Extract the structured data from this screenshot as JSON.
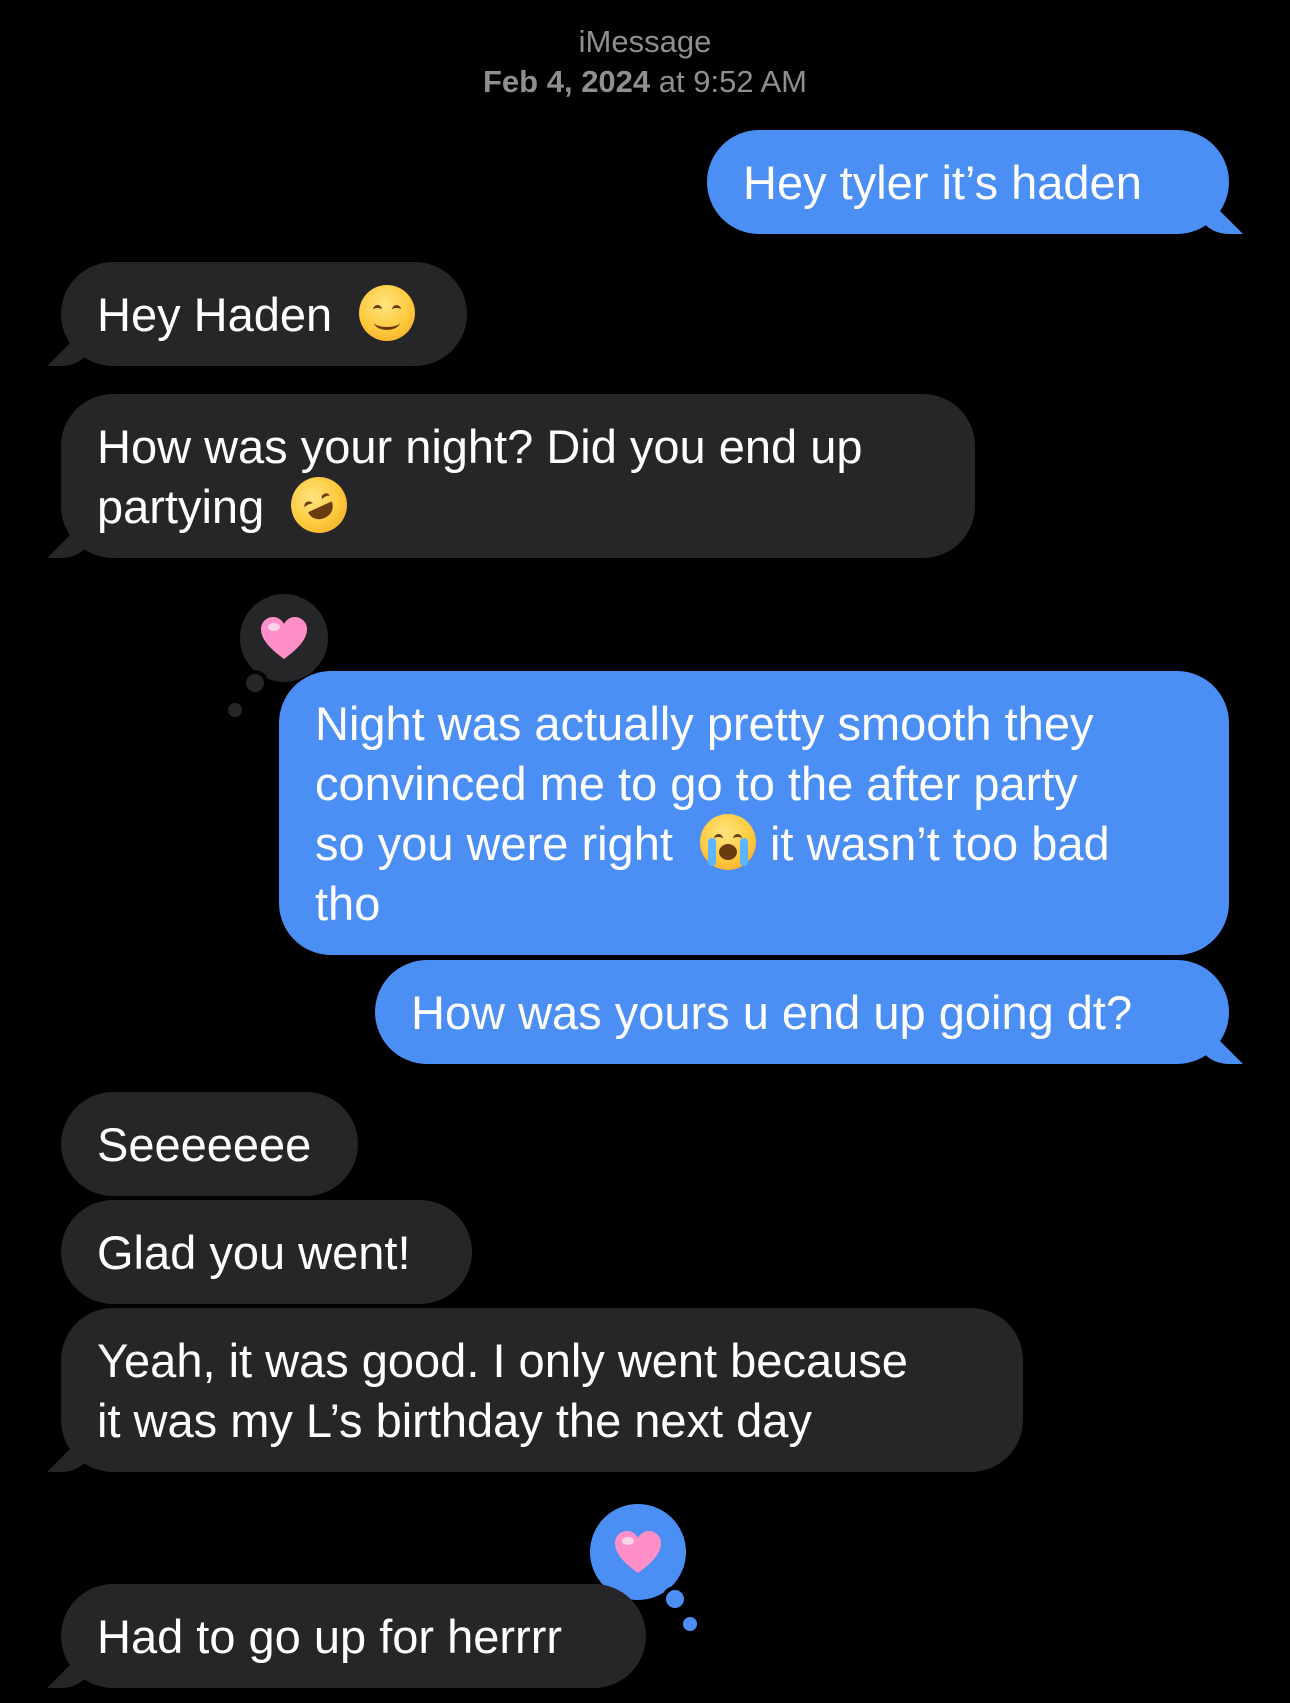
{
  "header": {
    "service": "iMessage",
    "date_bold": "Feb 4, 2024",
    "date_rest": " at 9:52 AM"
  },
  "messages": [
    {
      "side": "out",
      "text": "Hey tyler it’s haden"
    },
    {
      "side": "in",
      "text": "Hey Haden",
      "emoji": "smiling-face"
    },
    {
      "side": "in",
      "lines": [
        "How was your night? Did you end up",
        "partying"
      ],
      "emoji": "rofl-face"
    },
    {
      "side": "out",
      "lines": [
        "Night was actually pretty smooth they",
        "convinced me to go to the after party",
        "so you were right",
        "it wasn’t too bad",
        "tho"
      ],
      "emoji": "crying-face",
      "tapback": "heart"
    },
    {
      "side": "out",
      "text": "How was yours u end up going dt?"
    },
    {
      "side": "in",
      "text": "Seeeeeee"
    },
    {
      "side": "in",
      "text": "Glad you went!"
    },
    {
      "side": "in",
      "lines": [
        "Yeah, it was good. I only went because",
        "it was my L’s birthday the next day"
      ]
    },
    {
      "side": "in",
      "text": "Had to go up for herrrr",
      "tapback": "heart"
    }
  ],
  "colors": {
    "outgoing": "#4b8ff5",
    "incoming": "#262628",
    "heart": "#ff8fc8"
  }
}
